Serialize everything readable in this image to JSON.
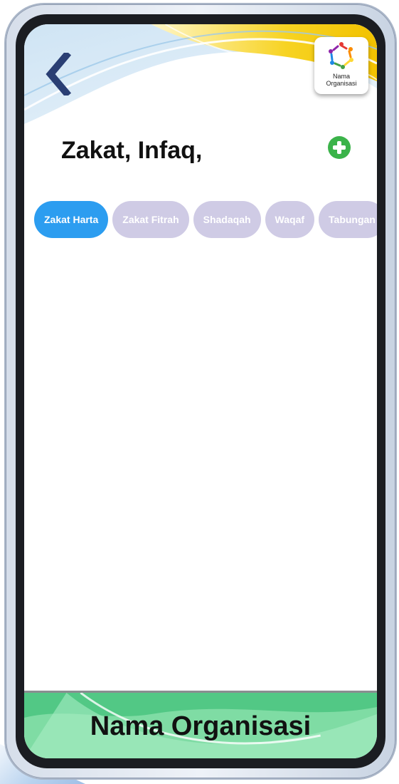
{
  "header": {
    "logo_caption_line1": "Nama",
    "logo_caption_line2": "Organisasi",
    "title": "Zakat, Infaq,"
  },
  "tabs": [
    {
      "label": "Zakat Harta",
      "active": true
    },
    {
      "label": "Zakat Fitrah",
      "active": false
    },
    {
      "label": "Shadaqah",
      "active": false
    },
    {
      "label": "Waqaf",
      "active": false
    },
    {
      "label": "Tabungan",
      "active": false
    }
  ],
  "footer": {
    "title": "Nama Organisasi"
  },
  "icons": {
    "back": "chevron-left-icon",
    "add": "plus-circle-icon",
    "logo": "people-circle-icon"
  },
  "colors": {
    "active_tab": "#2c9df0",
    "inactive_tab": "#cfcbe5",
    "add_button": "#3bb34a",
    "back_chevron": "#2a3f74",
    "footer_green": "#6fd49a"
  }
}
